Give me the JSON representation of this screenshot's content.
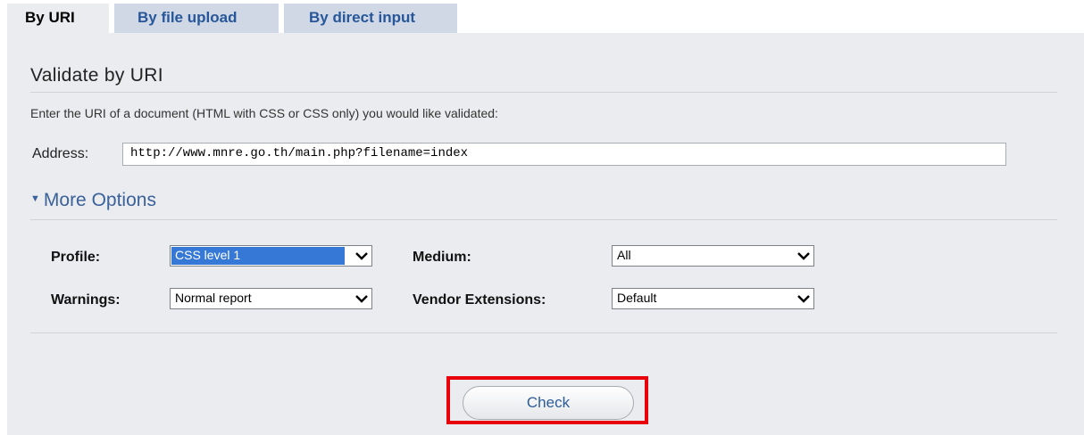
{
  "tabs": [
    {
      "label": "By URI",
      "active": true
    },
    {
      "label": "By file upload",
      "active": false
    },
    {
      "label": "By direct input",
      "active": false
    }
  ],
  "panel": {
    "heading": "Validate by URI",
    "intro": "Enter the URI of a document (HTML with CSS or CSS only) you would like validated:",
    "address_label": "Address:",
    "address_value": "http://www.mnre.go.th/main.php?filename=index"
  },
  "more_options": {
    "label": "More Options",
    "profile": {
      "label": "Profile:",
      "value": "CSS level 1"
    },
    "medium": {
      "label": "Medium:",
      "value": "All"
    },
    "warnings": {
      "label": "Warnings:",
      "value": "Normal report"
    },
    "vendor": {
      "label": "Vendor Extensions:",
      "value": "Default"
    }
  },
  "check_label": "Check",
  "colors": {
    "panel_bg": "#eaecef",
    "link_blue": "#27579a",
    "highlight": "#e8000b"
  }
}
